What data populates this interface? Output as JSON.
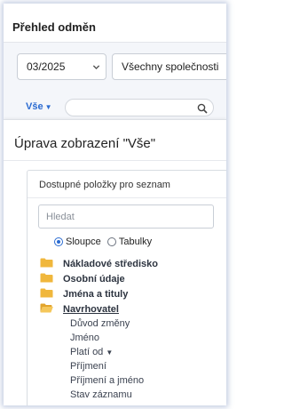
{
  "header": {
    "title": "Přehled odměn"
  },
  "filters": {
    "month": {
      "value": "03/2025"
    },
    "company": {
      "value": "Všechny společnosti"
    }
  },
  "view_selector": {
    "label": "Vše"
  },
  "search": {
    "placeholder": ""
  },
  "panel": {
    "title": "Úprava zobrazení \"Vše\"",
    "section_title": "Dostupné položky pro seznam",
    "filter_placeholder": "Hledat",
    "radio_options": [
      {
        "label": "Sloupce",
        "checked": true
      },
      {
        "label": "Tabulky",
        "checked": false
      }
    ],
    "folders": [
      {
        "label": "Nákladové středisko"
      },
      {
        "label": "Osobní údaje"
      },
      {
        "label": "Jména a tituly"
      },
      {
        "label": "Navrhovatel",
        "expanded": true
      }
    ],
    "items": [
      {
        "label": "Důvod změny"
      },
      {
        "label": "Jméno"
      },
      {
        "label": "Platí od",
        "has_dropdown": true
      },
      {
        "label": "Příjmení"
      },
      {
        "label": "Příjmení a jméno"
      },
      {
        "label": "Stav záznamu"
      }
    ]
  },
  "colors": {
    "accent": "#2b6bd1",
    "folder": "#f0b73c"
  },
  "icons": [
    "chevron-down-icon",
    "search-icon",
    "folder-icon",
    "folder-open-icon",
    "caret-down-icon"
  ]
}
